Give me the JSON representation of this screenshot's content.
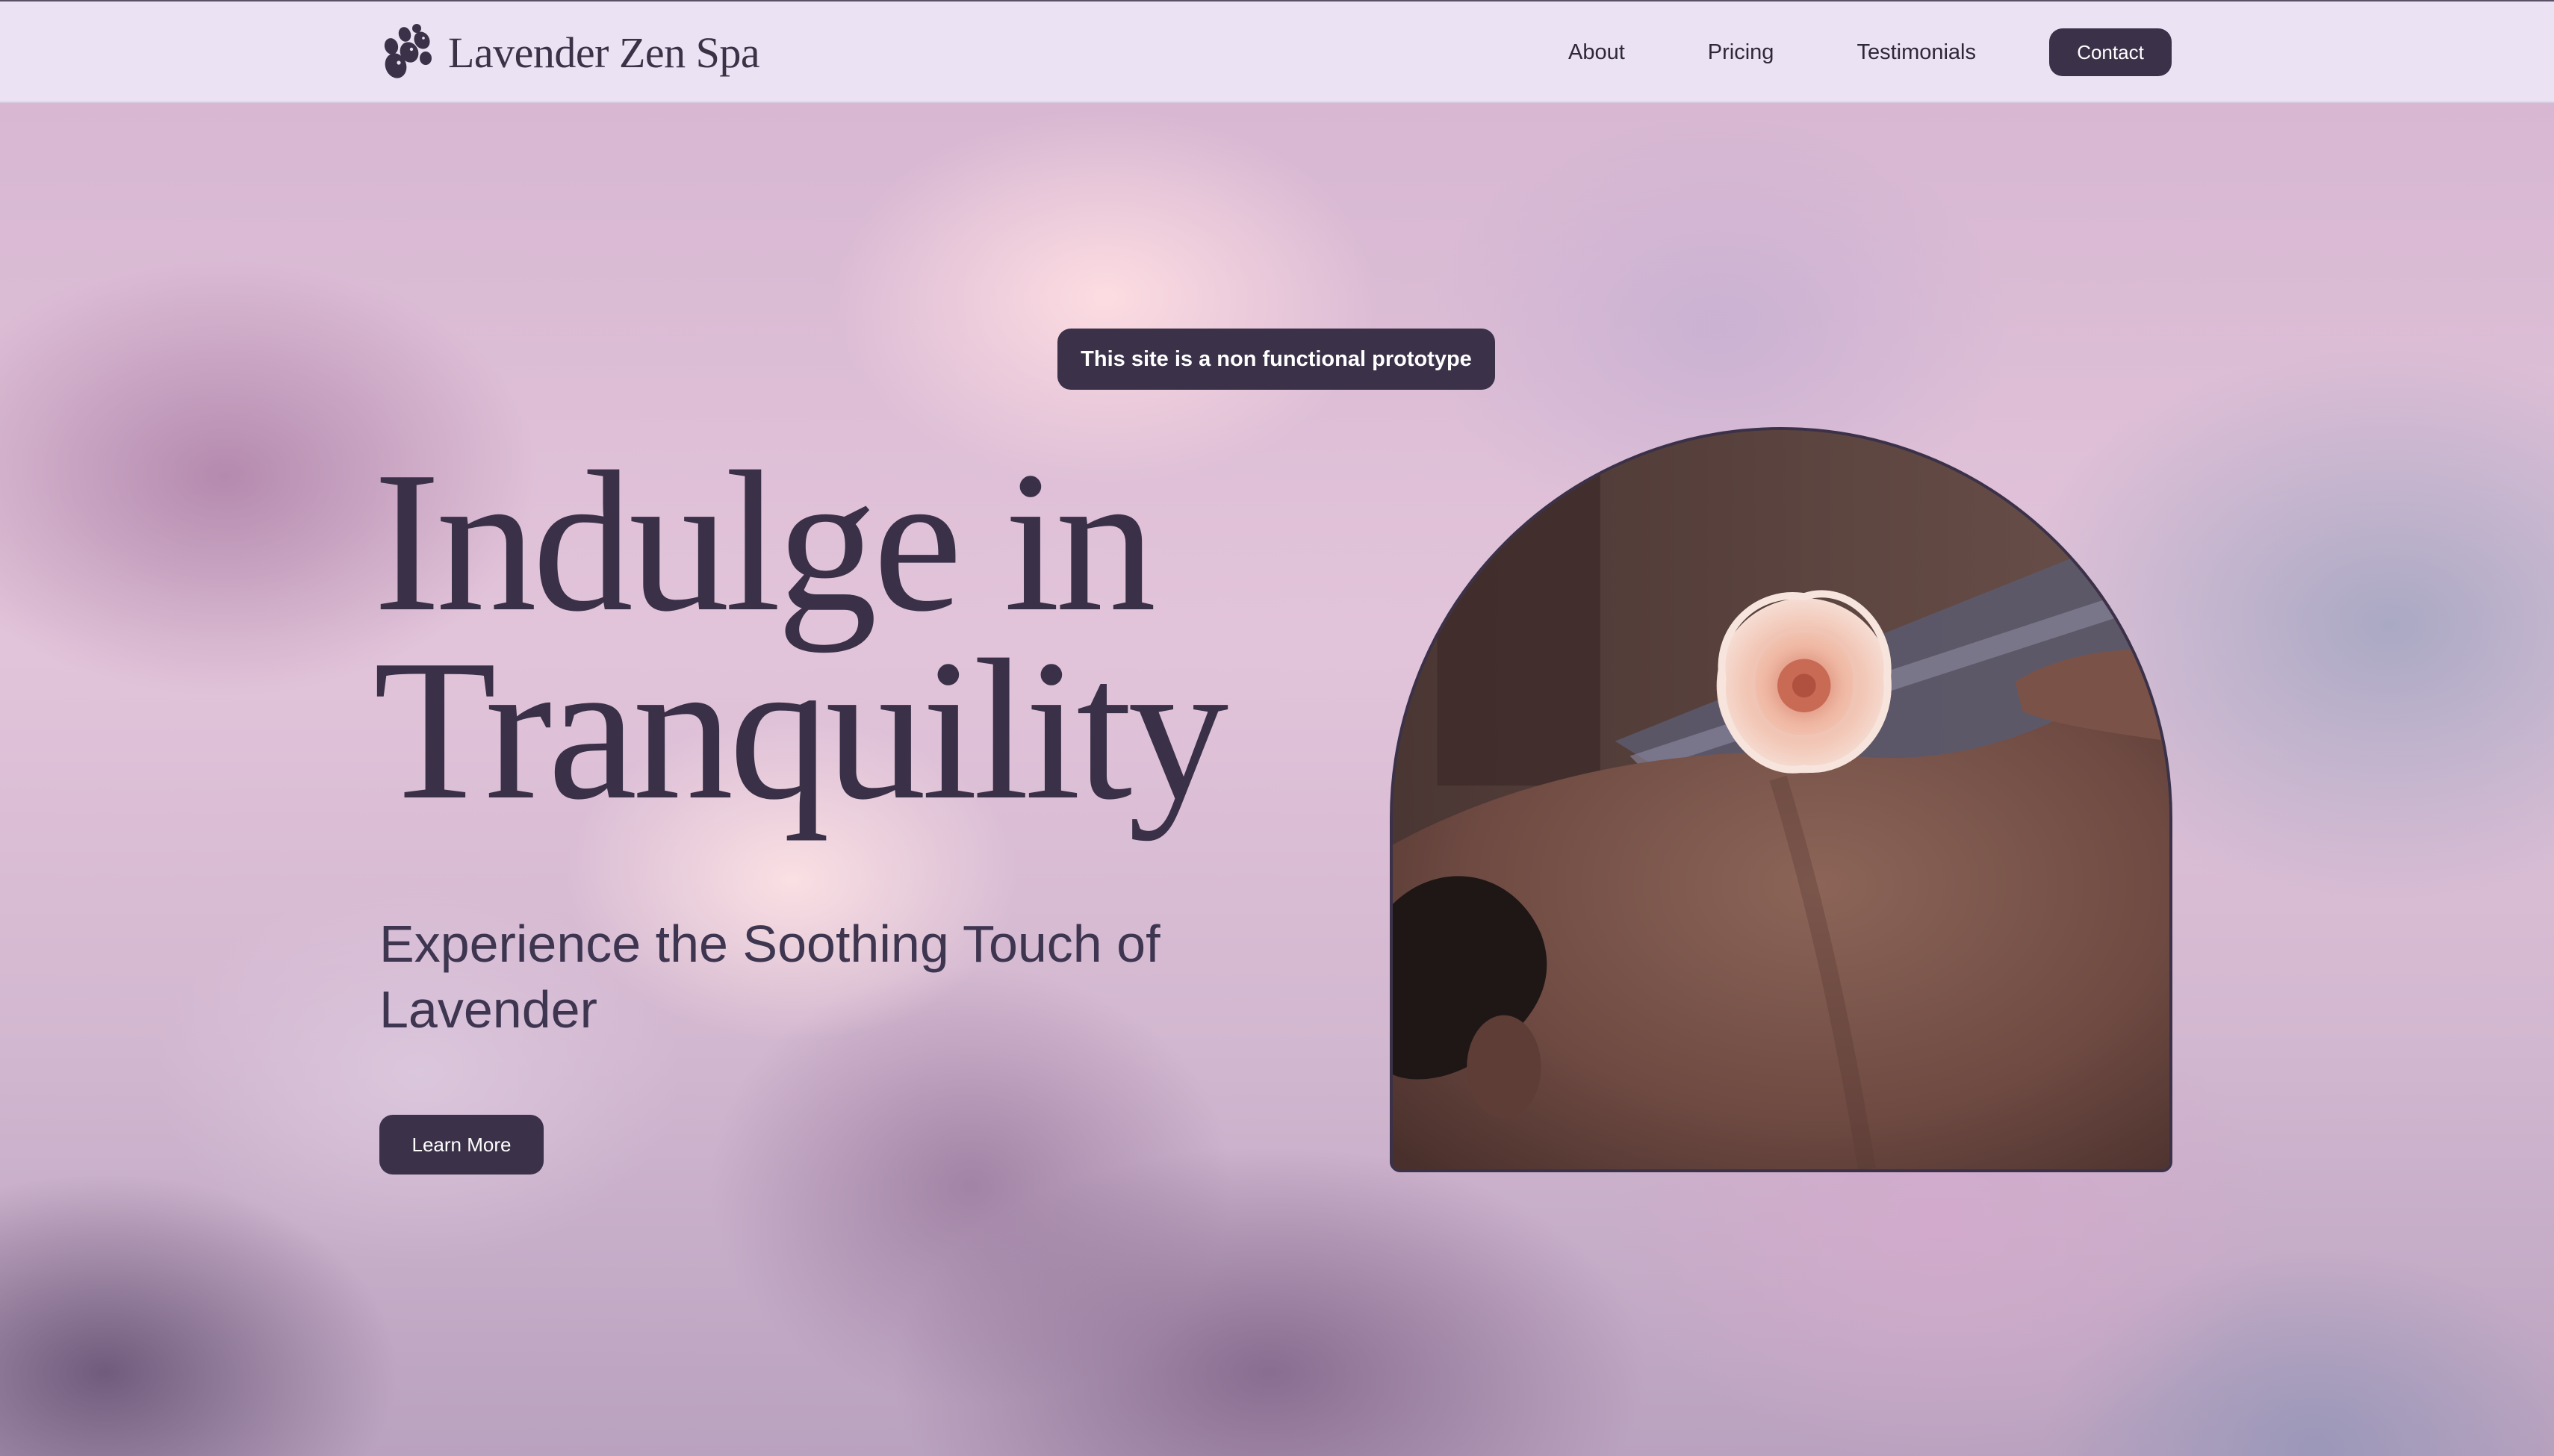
{
  "header": {
    "brand_name": "Lavender Zen Spa",
    "brand_icon": "lavender-flower-icon",
    "nav": [
      {
        "label": "About"
      },
      {
        "label": "Pricing"
      },
      {
        "label": "Testimonials"
      }
    ],
    "contact_label": "Contact"
  },
  "notice": {
    "text": "This site is a non functional prototype"
  },
  "hero": {
    "title_line1": "Indulge in",
    "title_line2": "Tranquility",
    "subtitle": "Experience the Soothing Touch of Lavender",
    "cta_label": "Learn More"
  },
  "colors": {
    "primary": "#3b3149",
    "header_bg": "#ebe3f3",
    "text_dark": "#3a3148"
  }
}
